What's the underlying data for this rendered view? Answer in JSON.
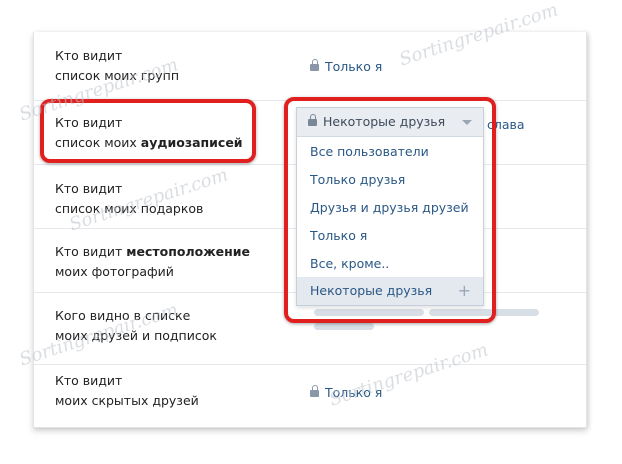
{
  "watermark_text": "Sortingrepair.com",
  "rows": [
    {
      "line1": "Кто видит",
      "line2": "список моих групп",
      "value": "Только я"
    },
    {
      "line1": "Кто видит",
      "line2_normal": "список моих ",
      "line2_bold": "аудиозаписей",
      "value_tail": "слава"
    },
    {
      "line1": "Кто видит",
      "line2": "список моих подарков"
    },
    {
      "line1_normal": "Кто видит ",
      "line1_bold": "местоположение",
      "line2": "моих фотографий"
    },
    {
      "line1": "Кого видно в списке",
      "line2": "моих друзей и подписок"
    },
    {
      "line1": "Кто видит",
      "line2": "моих скрытых друзей",
      "value": "Только я"
    }
  ],
  "dropdown": {
    "selected": "Некоторые друзья",
    "options": [
      "Все пользователи",
      "Только друзья",
      "Друзья и друзья друзей",
      "Только я",
      "Все, кроме..",
      "Некоторые друзья"
    ],
    "add_symbol": "+"
  },
  "colors": {
    "link": "#2a5885",
    "highlight": "#e0201e",
    "selected_bg": "#e4e9ef"
  }
}
